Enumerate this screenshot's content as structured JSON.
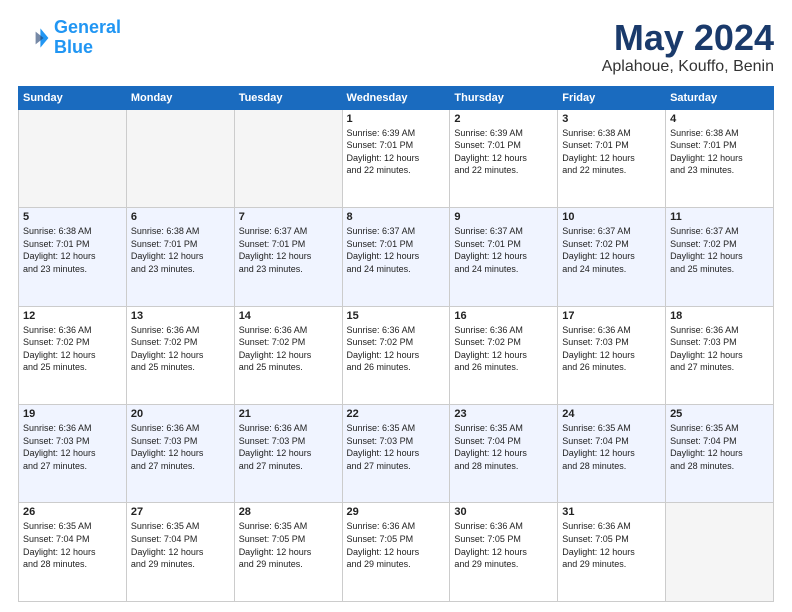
{
  "logo": {
    "line1": "General",
    "line2": "Blue"
  },
  "title": "May 2024",
  "subtitle": "Aplahoue, Kouffo, Benin",
  "days_header": [
    "Sunday",
    "Monday",
    "Tuesday",
    "Wednesday",
    "Thursday",
    "Friday",
    "Saturday"
  ],
  "weeks": [
    [
      {
        "num": "",
        "info": ""
      },
      {
        "num": "",
        "info": ""
      },
      {
        "num": "",
        "info": ""
      },
      {
        "num": "1",
        "info": "Sunrise: 6:39 AM\nSunset: 7:01 PM\nDaylight: 12 hours\nand 22 minutes."
      },
      {
        "num": "2",
        "info": "Sunrise: 6:39 AM\nSunset: 7:01 PM\nDaylight: 12 hours\nand 22 minutes."
      },
      {
        "num": "3",
        "info": "Sunrise: 6:38 AM\nSunset: 7:01 PM\nDaylight: 12 hours\nand 22 minutes."
      },
      {
        "num": "4",
        "info": "Sunrise: 6:38 AM\nSunset: 7:01 PM\nDaylight: 12 hours\nand 23 minutes."
      }
    ],
    [
      {
        "num": "5",
        "info": "Sunrise: 6:38 AM\nSunset: 7:01 PM\nDaylight: 12 hours\nand 23 minutes."
      },
      {
        "num": "6",
        "info": "Sunrise: 6:38 AM\nSunset: 7:01 PM\nDaylight: 12 hours\nand 23 minutes."
      },
      {
        "num": "7",
        "info": "Sunrise: 6:37 AM\nSunset: 7:01 PM\nDaylight: 12 hours\nand 23 minutes."
      },
      {
        "num": "8",
        "info": "Sunrise: 6:37 AM\nSunset: 7:01 PM\nDaylight: 12 hours\nand 24 minutes."
      },
      {
        "num": "9",
        "info": "Sunrise: 6:37 AM\nSunset: 7:01 PM\nDaylight: 12 hours\nand 24 minutes."
      },
      {
        "num": "10",
        "info": "Sunrise: 6:37 AM\nSunset: 7:02 PM\nDaylight: 12 hours\nand 24 minutes."
      },
      {
        "num": "11",
        "info": "Sunrise: 6:37 AM\nSunset: 7:02 PM\nDaylight: 12 hours\nand 25 minutes."
      }
    ],
    [
      {
        "num": "12",
        "info": "Sunrise: 6:36 AM\nSunset: 7:02 PM\nDaylight: 12 hours\nand 25 minutes."
      },
      {
        "num": "13",
        "info": "Sunrise: 6:36 AM\nSunset: 7:02 PM\nDaylight: 12 hours\nand 25 minutes."
      },
      {
        "num": "14",
        "info": "Sunrise: 6:36 AM\nSunset: 7:02 PM\nDaylight: 12 hours\nand 25 minutes."
      },
      {
        "num": "15",
        "info": "Sunrise: 6:36 AM\nSunset: 7:02 PM\nDaylight: 12 hours\nand 26 minutes."
      },
      {
        "num": "16",
        "info": "Sunrise: 6:36 AM\nSunset: 7:02 PM\nDaylight: 12 hours\nand 26 minutes."
      },
      {
        "num": "17",
        "info": "Sunrise: 6:36 AM\nSunset: 7:03 PM\nDaylight: 12 hours\nand 26 minutes."
      },
      {
        "num": "18",
        "info": "Sunrise: 6:36 AM\nSunset: 7:03 PM\nDaylight: 12 hours\nand 27 minutes."
      }
    ],
    [
      {
        "num": "19",
        "info": "Sunrise: 6:36 AM\nSunset: 7:03 PM\nDaylight: 12 hours\nand 27 minutes."
      },
      {
        "num": "20",
        "info": "Sunrise: 6:36 AM\nSunset: 7:03 PM\nDaylight: 12 hours\nand 27 minutes."
      },
      {
        "num": "21",
        "info": "Sunrise: 6:36 AM\nSunset: 7:03 PM\nDaylight: 12 hours\nand 27 minutes."
      },
      {
        "num": "22",
        "info": "Sunrise: 6:35 AM\nSunset: 7:03 PM\nDaylight: 12 hours\nand 27 minutes."
      },
      {
        "num": "23",
        "info": "Sunrise: 6:35 AM\nSunset: 7:04 PM\nDaylight: 12 hours\nand 28 minutes."
      },
      {
        "num": "24",
        "info": "Sunrise: 6:35 AM\nSunset: 7:04 PM\nDaylight: 12 hours\nand 28 minutes."
      },
      {
        "num": "25",
        "info": "Sunrise: 6:35 AM\nSunset: 7:04 PM\nDaylight: 12 hours\nand 28 minutes."
      }
    ],
    [
      {
        "num": "26",
        "info": "Sunrise: 6:35 AM\nSunset: 7:04 PM\nDaylight: 12 hours\nand 28 minutes."
      },
      {
        "num": "27",
        "info": "Sunrise: 6:35 AM\nSunset: 7:04 PM\nDaylight: 12 hours\nand 29 minutes."
      },
      {
        "num": "28",
        "info": "Sunrise: 6:35 AM\nSunset: 7:05 PM\nDaylight: 12 hours\nand 29 minutes."
      },
      {
        "num": "29",
        "info": "Sunrise: 6:36 AM\nSunset: 7:05 PM\nDaylight: 12 hours\nand 29 minutes."
      },
      {
        "num": "30",
        "info": "Sunrise: 6:36 AM\nSunset: 7:05 PM\nDaylight: 12 hours\nand 29 minutes."
      },
      {
        "num": "31",
        "info": "Sunrise: 6:36 AM\nSunset: 7:05 PM\nDaylight: 12 hours\nand 29 minutes."
      },
      {
        "num": "",
        "info": ""
      }
    ]
  ]
}
